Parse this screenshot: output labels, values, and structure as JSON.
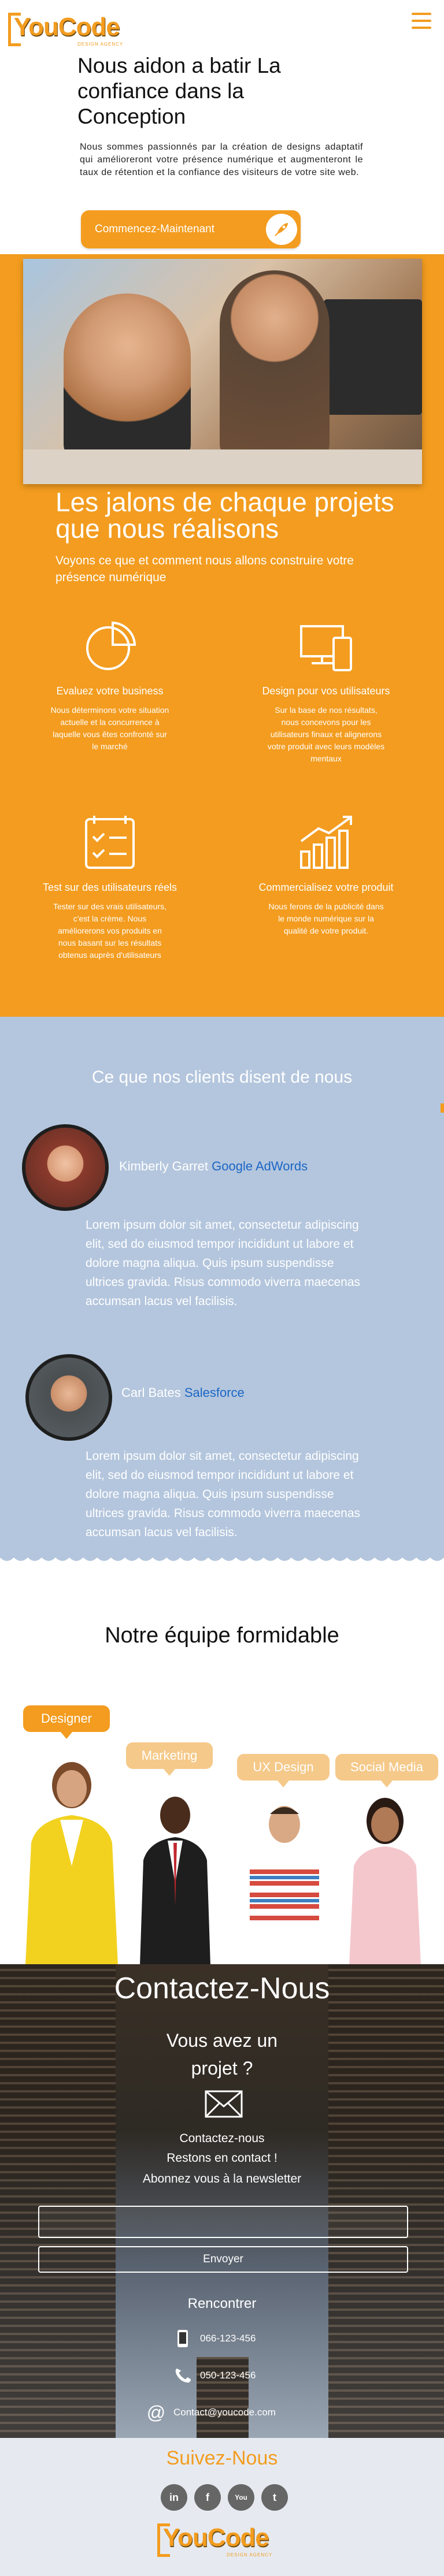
{
  "header": {
    "logo_text": "YouCode",
    "logo_sub": "DESIGN AGENCY",
    "menu_icon": "hamburger-icon"
  },
  "hero": {
    "title": "Nous aidon a batir La confiance dans la Conception",
    "text": "Nous sommes passionnés par la création de designs adaptatif qui amélioreront votre présence numérique et augmenteront le taux de rétention et la confiance des visiteurs de votre site web.",
    "cta_label": "Commencez-Maintenant",
    "cta_icon": "rocket-icon"
  },
  "jalons": {
    "title": "Les jalons de chaque projets que nous réalisons",
    "text": "Voyons ce que et comment nous allons construire votre présence numérique",
    "features": [
      {
        "icon": "pie-chart-icon",
        "title": "Evaluez votre business",
        "text": "Nous déterminons votre situation actuelle et la concurrence à laquelle vous êtes confronté sur le marché"
      },
      {
        "icon": "devices-icon",
        "title": "Design pour vos utilisateurs",
        "text": "Sur la base de nos résultats, nous concevons pour les utilisateurs finaux et alignerons votre produit avec leurs modèles mentaux"
      },
      {
        "icon": "checklist-icon",
        "title": "Test sur des utilisateurs réels",
        "text": "Tester sur des vrais utilisateurs, c'est la crème. Nous améliorerons vos produits en nous basant sur les résultats obtenus auprès d'utilisateurs"
      },
      {
        "icon": "growth-chart-icon",
        "title": "Commercialisez votre produit",
        "text": "Nous ferons de la publicité dans le monde numérique sur la qualité de votre produit."
      }
    ]
  },
  "testimonials": {
    "title": "Ce que nos clients disent de nous",
    "items": [
      {
        "name": "Kimberly Garret",
        "company": "Google AdWords",
        "quote": "Lorem ipsum dolor sit amet, consectetur adipiscing elit, sed do eiusmod tempor incididunt ut labore et dolore magna aliqua. Quis ipsum suspendisse ultrices gravida. Risus commodo viverra maecenas accumsan lacus vel facilisis."
      },
      {
        "name": "Carl Bates",
        "company": "Salesforce",
        "quote": "Lorem ipsum dolor sit amet, consectetur adipiscing elit, sed do eiusmod tempor incididunt ut labore et dolore magna aliqua. Quis ipsum suspendisse ultrices gravida. Risus commodo viverra maecenas accumsan lacus vel facilisis."
      }
    ]
  },
  "team": {
    "title": "Notre équipe formidable",
    "members": [
      {
        "role": "Designer"
      },
      {
        "role": "Marketing"
      },
      {
        "role": "UX Design"
      },
      {
        "role": "Social Media"
      }
    ]
  },
  "contact": {
    "title": "Contactez-Nous",
    "question": "Vous avez un projet ?",
    "line1": "Contactez-nous",
    "line2": "Restons en contact !",
    "line3": "Abonnez vous à la newsletter",
    "send_label": "Envoyer",
    "meet": "Rencontrer",
    "phone1": "066-123-456",
    "phone2": "050-123-456",
    "email": "Contact@youcode.com"
  },
  "footer": {
    "follow": "Suivez-Nous",
    "socials": [
      {
        "name": "linkedin",
        "glyph": "in"
      },
      {
        "name": "facebook",
        "glyph": "f"
      },
      {
        "name": "youtube",
        "glyph": "You"
      },
      {
        "name": "twitter",
        "glyph": "t"
      }
    ],
    "logo_text": "YouCode",
    "logo_sub": "DESIGN AGENCY"
  },
  "colors": {
    "accent": "#f39c1f",
    "testimonial_bg": "#b4c6dd",
    "link": "#1b66c6"
  }
}
